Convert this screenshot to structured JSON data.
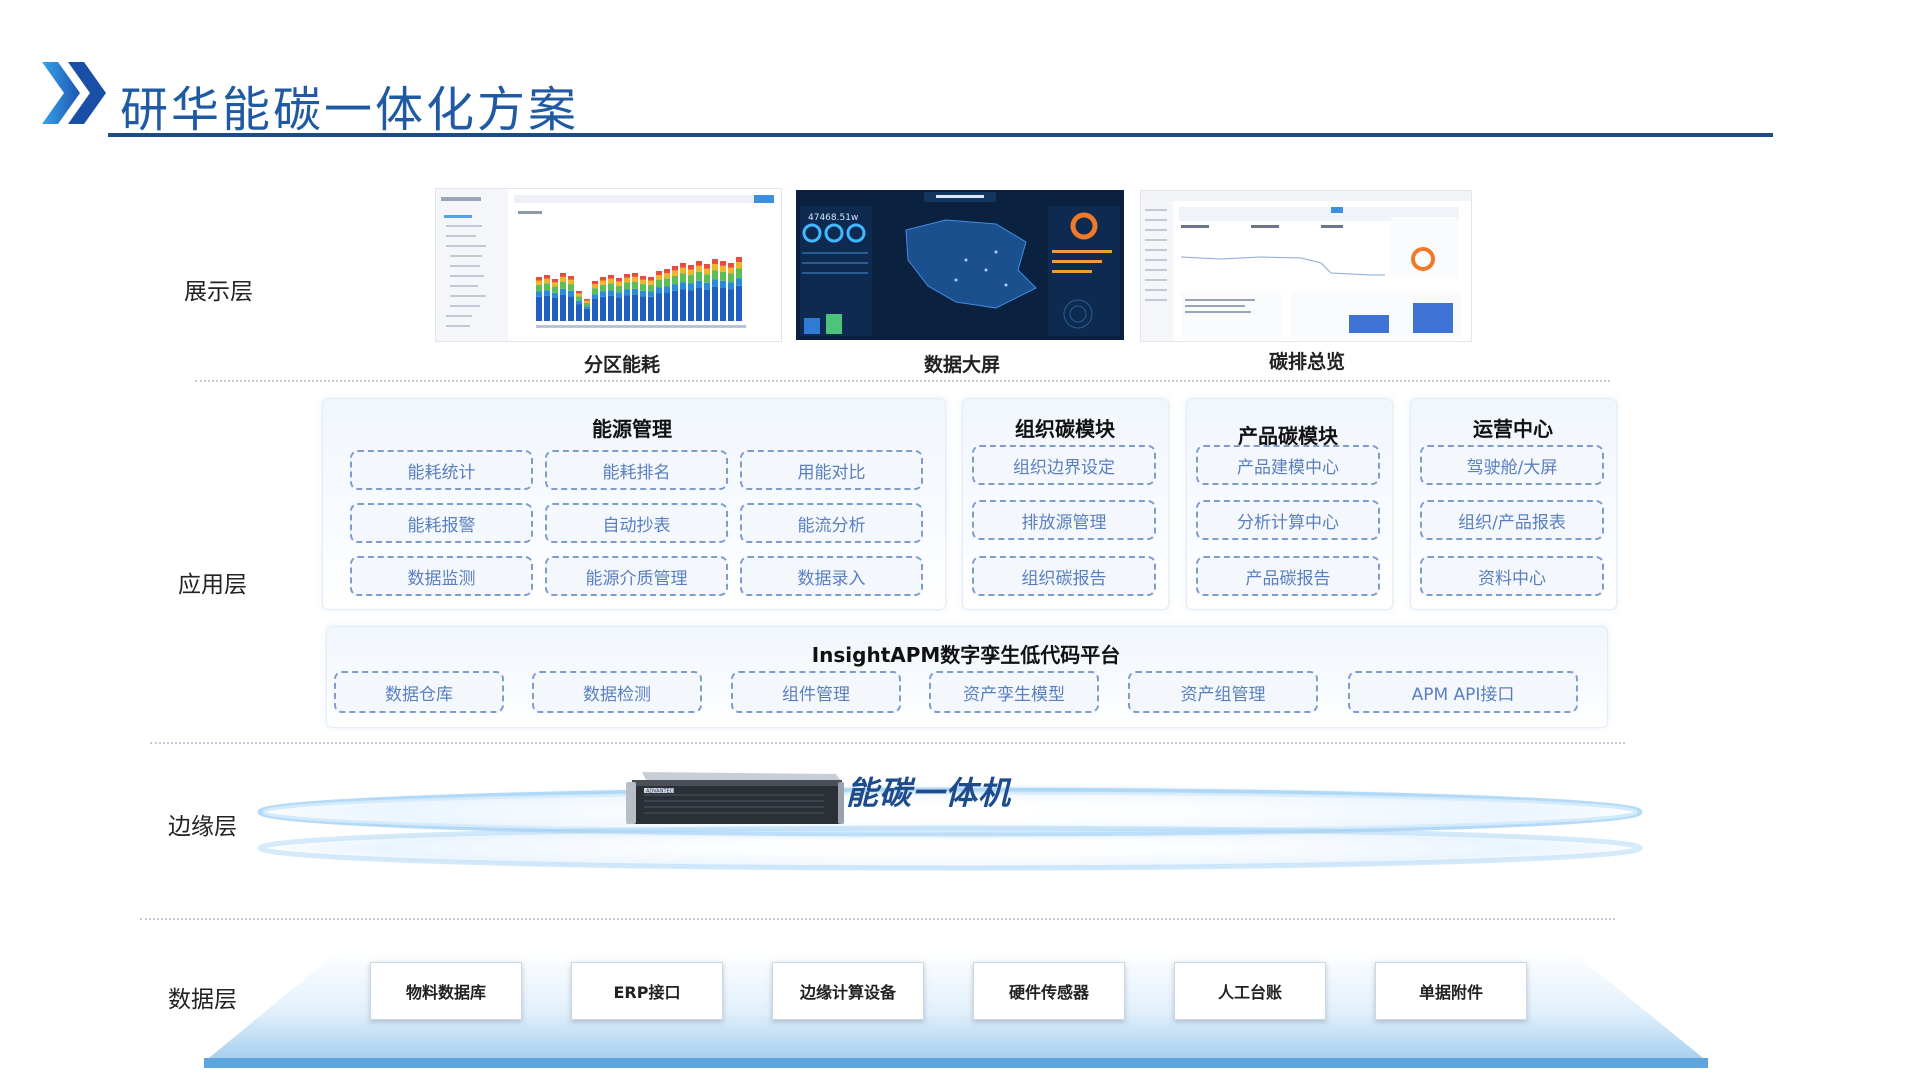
{
  "title": "研华能碳一体化方案",
  "layers": {
    "presentation": "展示层",
    "application": "应用层",
    "edge": "边缘层",
    "data": "数据层"
  },
  "thumbnails": [
    {
      "caption": "分区能耗"
    },
    {
      "caption": "数据大屏",
      "kpi": "47468.51w"
    },
    {
      "caption": "碳排总览"
    }
  ],
  "app_panels": [
    {
      "title": "能源管理",
      "items": [
        "能耗统计",
        "能耗排名",
        "用能对比",
        "能耗报警",
        "自动抄表",
        "能流分析",
        "数据监测",
        "能源介质管理",
        "数据录入"
      ]
    },
    {
      "title": "组织碳模块",
      "items": [
        "组织边界设定",
        "排放源管理",
        "组织碳报告"
      ]
    },
    {
      "title": "产品碳模块",
      "items": [
        "产品建模中心",
        "分析计算中心",
        "产品碳报告"
      ]
    },
    {
      "title": "运营中心",
      "items": [
        "驾驶舱/大屏",
        "组织/产品报表",
        "资料中心"
      ]
    }
  ],
  "platform": {
    "title": "InsightAPM数字孪生低代码平台",
    "items": [
      "数据仓库",
      "数据检测",
      "组件管理",
      "资产孪生模型",
      "资产组管理",
      "APM API接口"
    ]
  },
  "edge": {
    "device_label": "能碳一体机",
    "device_brand": "ADVANTECH"
  },
  "data_sources": [
    "物料数据库",
    "ERP接口",
    "边缘计算设备",
    "硬件传感器",
    "人工台账",
    "单据附件"
  ],
  "colors": {
    "title_blue": "#1f5aa3",
    "rule_navy": "#1c4b8a",
    "module_border": "#7f9dcc",
    "module_text": "#5a7fc0",
    "device_label": "#1e4b8c"
  }
}
